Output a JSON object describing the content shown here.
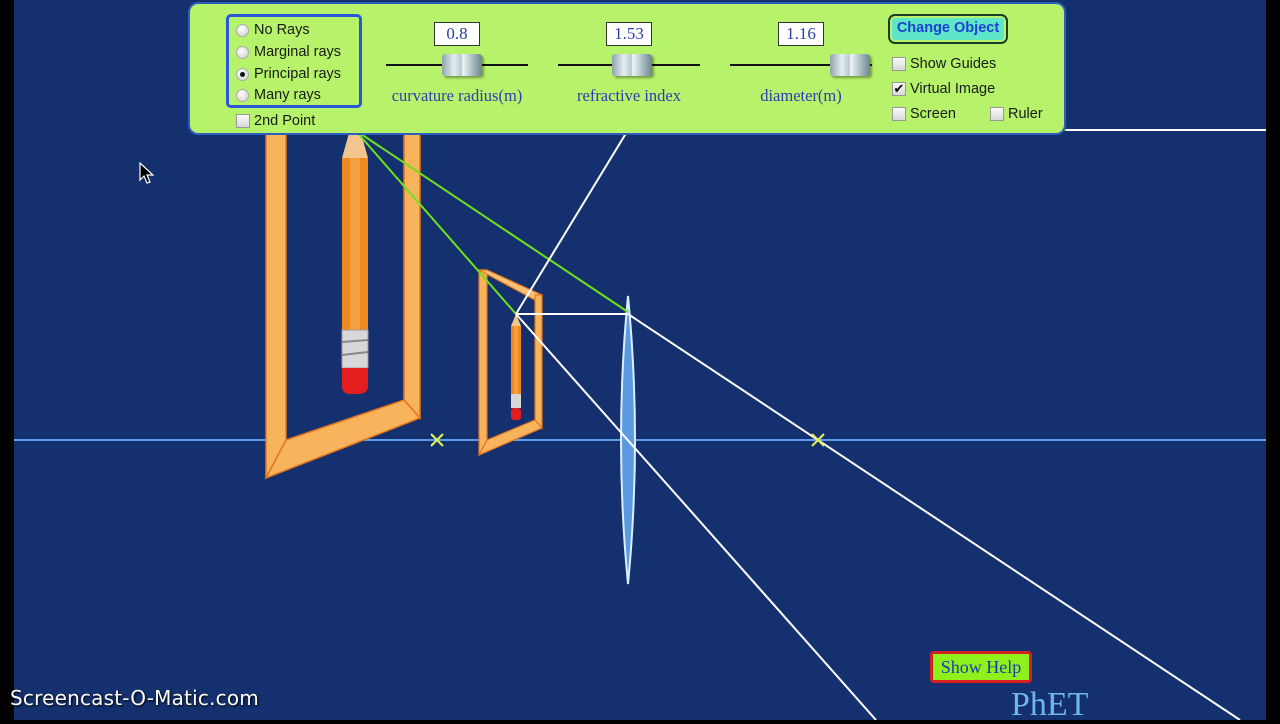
{
  "app": {
    "name": "PhET Geometric Optics",
    "logo_text": "PhET",
    "watermark": "Screencast-O-Matic.com"
  },
  "ray_options": {
    "items": [
      {
        "label": "No Rays",
        "selected": false
      },
      {
        "label": "Marginal rays",
        "selected": false
      },
      {
        "label": "Principal rays",
        "selected": true
      },
      {
        "label": "Many rays",
        "selected": false
      }
    ]
  },
  "second_point": {
    "label": "2nd Point",
    "checked": false
  },
  "sliders": [
    {
      "label": "curvature radius(m)",
      "value": "0.8",
      "position": 0.5
    },
    {
      "label": "refractive index",
      "value": "1.53",
      "position": 0.5
    },
    {
      "label": "diameter(m)",
      "value": "1.16",
      "position": 0.9
    }
  ],
  "change_object_label": "Change Object",
  "options": {
    "show_guides": {
      "label": "Show Guides",
      "checked": false
    },
    "virtual_image": {
      "label": "Virtual Image",
      "checked": true
    },
    "screen": {
      "label": "Screen",
      "checked": false
    },
    "ruler": {
      "label": "Ruler",
      "checked": false
    }
  },
  "show_help_label": "Show Help",
  "colors": {
    "background": "#14306e",
    "panel": "#b6f26a",
    "axis": "#5b9de8",
    "ray_white": "#ffffff",
    "ray_green": "#6fe21a",
    "focal_marker": "#e3f05a",
    "frame": "#f7b45c",
    "frame_edge": "#e4761c",
    "lens": "#5b9ae0"
  },
  "check_mark": "✔"
}
